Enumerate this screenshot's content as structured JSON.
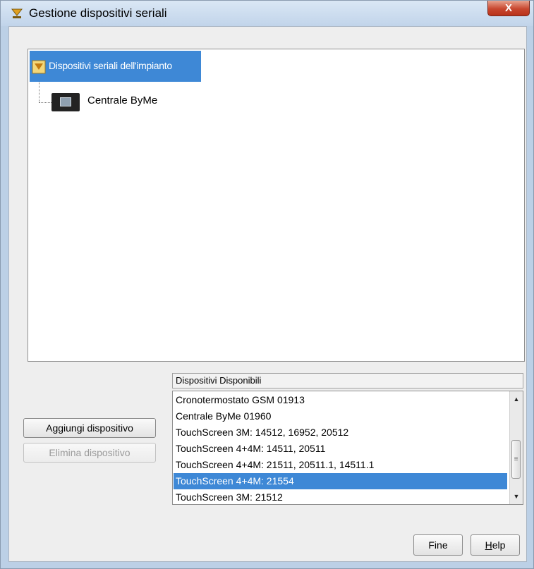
{
  "window": {
    "title": "Gestione dispositivi seriali",
    "close_label": "X",
    "icon": "serial-devices-app-icon"
  },
  "tree": {
    "root": {
      "label": "Dispositivi seriali dell'impianto",
      "icon": "system-folder-icon",
      "selected": true
    },
    "children": [
      {
        "label": "Centrale ByMe",
        "icon": "device-panel-icon"
      }
    ]
  },
  "available": {
    "header": "Dispositivi Disponibili",
    "items": [
      "Cronotermostato GSM 01913",
      "Centrale ByMe 01960",
      "TouchScreen 3M: 14512, 16952, 20512",
      "TouchScreen 4+4M: 14511, 20511",
      "TouchScreen 4+4M: 21511, 20511.1, 14511.1",
      "TouchScreen 4+4M: 21554",
      "TouchScreen 3M: 21512"
    ],
    "selected_index": 5
  },
  "buttons": {
    "add": "Aggiungi dispositivo",
    "delete": "Elimina dispositivo",
    "fine": "Fine",
    "help": "Help"
  },
  "colors": {
    "selection": "#3e88d6",
    "window_frame": "#bcd0e6",
    "close_button": "#c8472f"
  }
}
